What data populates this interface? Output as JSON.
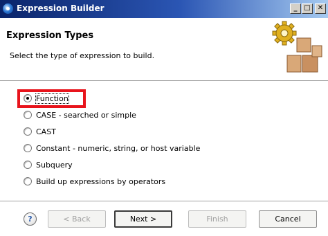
{
  "window": {
    "title": "Expression Builder"
  },
  "titlebar_buttons": {
    "minimize": "_",
    "maximize": "□",
    "close": "✕"
  },
  "header": {
    "title": "Expression Types",
    "description": "Select the type of expression to build."
  },
  "options": [
    {
      "label": "Function",
      "checked": true
    },
    {
      "label": "CASE - searched or simple",
      "checked": false
    },
    {
      "label": "CAST",
      "checked": false
    },
    {
      "label": "Constant - numeric, string, or host variable",
      "checked": false
    },
    {
      "label": "Subquery",
      "checked": false
    },
    {
      "label": "Build up expressions by operators",
      "checked": false
    }
  ],
  "buttons": {
    "help": "?",
    "back": "< Back",
    "next": "Next >",
    "finish": "Finish",
    "cancel": "Cancel"
  },
  "colors": {
    "highlight": "#e8141c",
    "titlebar": "#0a246a"
  },
  "icons": {
    "app": "expression-builder-icon",
    "banner": "gear-boxes-icon",
    "help": "help-icon"
  }
}
